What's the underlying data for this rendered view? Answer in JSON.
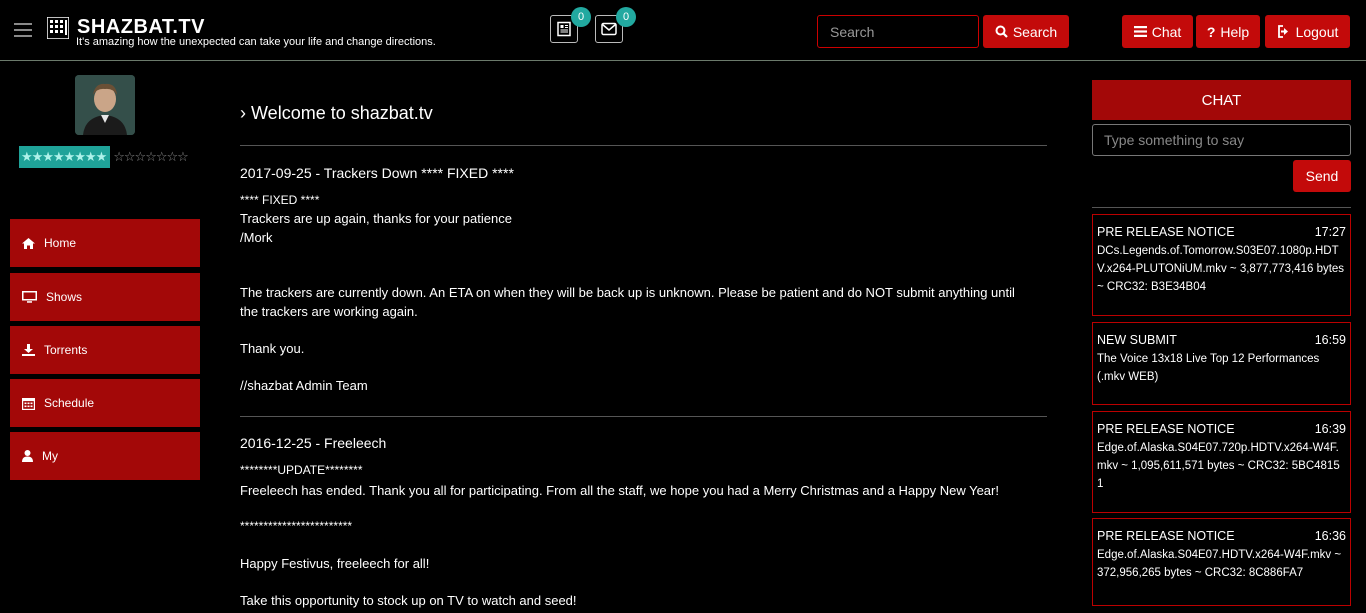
{
  "header": {
    "logo_text": "SHAZBAT.TV",
    "tagline": "It's amazing how the unexpected can take your life and change directions.",
    "news_badge": "0",
    "mail_badge": "0",
    "search_placeholder": "Search",
    "search_button": "Search",
    "chat_button": "Chat",
    "help_button": "Help",
    "logout_button": "Logout"
  },
  "sidebar": {
    "rating_filled": "★★★★★★★★",
    "rating_empty": "☆☆☆☆☆☆☆",
    "items": [
      {
        "label": "Home",
        "icon": "home-icon"
      },
      {
        "label": "Shows",
        "icon": "monitor-icon"
      },
      {
        "label": "Torrents",
        "icon": "download-icon"
      },
      {
        "label": "Schedule",
        "icon": "calendar-icon"
      },
      {
        "label": "My",
        "icon": "user-icon"
      }
    ]
  },
  "main": {
    "title": "Welcome to shazbat.tv",
    "news": [
      {
        "title": "2017-09-25 - Trackers Down **** FIXED ****",
        "lines": [
          "**** FIXED ****",
          "Trackers are up again, thanks for your patience",
          "/Mork",
          "The trackers are currently down. An ETA on when they will be back up is unknown. Please be patient and do NOT submit anything until",
          "the trackers are working again.",
          "Thank you.",
          "//shazbat Admin Team"
        ]
      },
      {
        "title": "2016-12-25 - Freeleech",
        "lines": [
          "********UPDATE********",
          "Freeleech has ended. Thank you all for participating. From all the staff, we hope you had a Merry Christmas and a Happy New Year!",
          "************************",
          "Happy Festivus, freeleech for all!",
          "Take this opportunity to stock up on TV to watch and seed!"
        ]
      }
    ]
  },
  "chat": {
    "header": "CHAT",
    "input_placeholder": "Type something to say",
    "send_button": "Send",
    "notices": [
      {
        "type": "PRE RELEASE NOTICE",
        "time": "17:27",
        "body": "DCs.Legends.of.Tomorrow.S03E07.1080p.HDTV.x264-PLUTONiUM.mkv ~ 3,877,773,416 bytes ~ CRC32: B3E34B04"
      },
      {
        "type": "NEW SUBMIT",
        "time": "16:59",
        "body": "The Voice 13x18 Live Top 12 Performances (.mkv WEB)"
      },
      {
        "type": "PRE RELEASE NOTICE",
        "time": "16:39",
        "body": "Edge.of.Alaska.S04E07.720p.HDTV.x264-W4F.mkv ~ 1,095,611,571 bytes ~ CRC32: 5BC48151"
      },
      {
        "type": "PRE RELEASE NOTICE",
        "time": "16:36",
        "body": "Edge.of.Alaska.S04E07.HDTV.x264-W4F.mkv ~ 372,956,265 bytes ~ CRC32: 8C886FA7"
      }
    ]
  },
  "colors": {
    "accent_red": "#c30a0a",
    "nav_red": "#a30808",
    "teal": "#22a9a0"
  }
}
